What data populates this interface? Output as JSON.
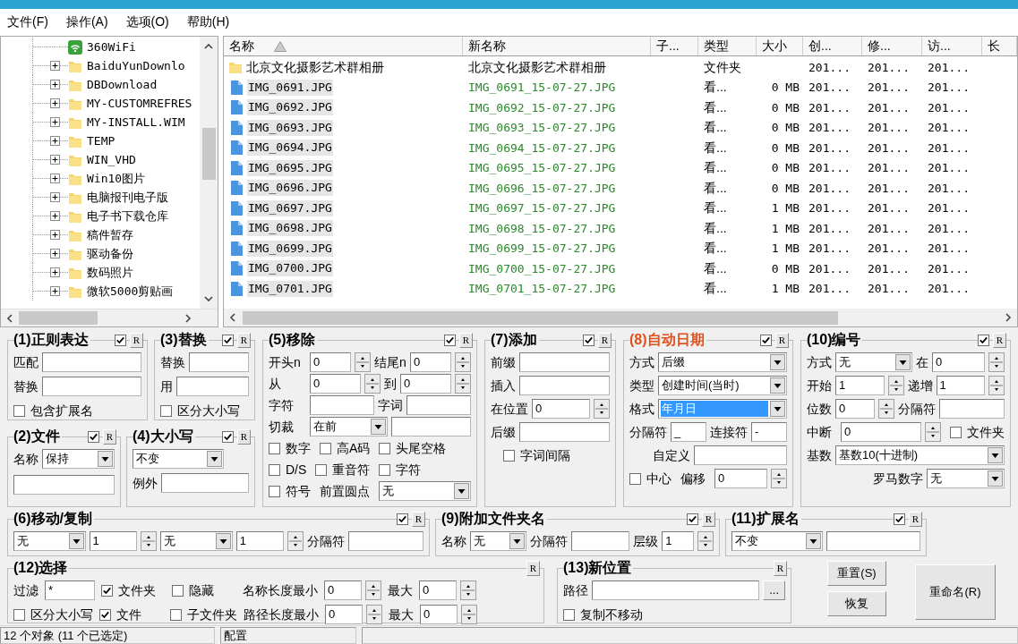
{
  "menu": [
    "文件(F)",
    "操作(A)",
    "选项(O)",
    "帮助(H)"
  ],
  "tree": {
    "items": [
      {
        "label": "360WiFi",
        "kind": "wifi"
      },
      {
        "label": "BaiduYunDownlo",
        "kind": "folder",
        "expanded": false
      },
      {
        "label": "DBDownload",
        "kind": "folder",
        "expanded": false
      },
      {
        "label": "MY-CUSTOMREFRES",
        "kind": "folder",
        "expanded": false
      },
      {
        "label": "MY-INSTALL.WIM",
        "kind": "folder",
        "expanded": false
      },
      {
        "label": "TEMP",
        "kind": "folder",
        "expanded": false
      },
      {
        "label": "WIN_VHD",
        "kind": "folder",
        "expanded": false
      },
      {
        "label": "Win10图片",
        "kind": "folder",
        "expanded": false
      },
      {
        "label": "电脑报刊电子版",
        "kind": "folder",
        "expanded": false
      },
      {
        "label": "电子书下载仓库",
        "kind": "folder",
        "expanded": false
      },
      {
        "label": "稿件暂存",
        "kind": "folder",
        "expanded": false
      },
      {
        "label": "驱动备份",
        "kind": "folder",
        "expanded": false
      },
      {
        "label": "数码照片",
        "kind": "folder",
        "expanded": false
      },
      {
        "label": "微软5000剪贴画",
        "kind": "folder",
        "expanded": false
      }
    ]
  },
  "file_list": {
    "columns": [
      {
        "label": "名称",
        "sorted": true
      },
      {
        "label": "新名称"
      },
      {
        "label": "子..."
      },
      {
        "label": "类型"
      },
      {
        "label": "大小"
      },
      {
        "label": "创..."
      },
      {
        "label": "修..."
      },
      {
        "label": "访..."
      },
      {
        "label": "长"
      }
    ],
    "rows": [
      {
        "kind": "folder",
        "selected": false,
        "name": "北京文化摄影艺术群相册",
        "new_name": "北京文化摄影艺术群相册",
        "changed": false,
        "type": "文件夹",
        "column_6": "201...",
        "column_7": "201...",
        "column_8": "201..."
      },
      {
        "kind": "image",
        "selected": true,
        "name": "IMG_0691.JPG",
        "new_name": "IMG_0691_15-07-27.JPG",
        "changed": true,
        "type": "看...",
        "size": "0 MB",
        "column_6": "201...",
        "column_7": "201...",
        "column_8": "201..."
      },
      {
        "kind": "image",
        "selected": true,
        "name": "IMG_0692.JPG",
        "new_name": "IMG_0692_15-07-27.JPG",
        "changed": true,
        "type": "看...",
        "size": "0 MB",
        "column_6": "201...",
        "column_7": "201...",
        "column_8": "201..."
      },
      {
        "kind": "image",
        "selected": true,
        "name": "IMG_0693.JPG",
        "new_name": "IMG_0693_15-07-27.JPG",
        "changed": true,
        "type": "看...",
        "size": "0 MB",
        "column_6": "201...",
        "column_7": "201...",
        "column_8": "201..."
      },
      {
        "kind": "image",
        "selected": true,
        "name": "IMG_0694.JPG",
        "new_name": "IMG_0694_15-07-27.JPG",
        "changed": true,
        "type": "看...",
        "size": "0 MB",
        "column_6": "201...",
        "column_7": "201...",
        "column_8": "201..."
      },
      {
        "kind": "image",
        "selected": true,
        "name": "IMG_0695.JPG",
        "new_name": "IMG_0695_15-07-27.JPG",
        "changed": true,
        "type": "看...",
        "size": "0 MB",
        "column_6": "201...",
        "column_7": "201...",
        "column_8": "201..."
      },
      {
        "kind": "image",
        "selected": true,
        "name": "IMG_0696.JPG",
        "new_name": "IMG_0696_15-07-27.JPG",
        "changed": true,
        "type": "看...",
        "size": "0 MB",
        "column_6": "201...",
        "column_7": "201...",
        "column_8": "201..."
      },
      {
        "kind": "image",
        "selected": true,
        "name": "IMG_0697.JPG",
        "new_name": "IMG_0697_15-07-27.JPG",
        "changed": true,
        "type": "看...",
        "size": "1 MB",
        "column_6": "201...",
        "column_7": "201...",
        "column_8": "201..."
      },
      {
        "kind": "image",
        "selected": true,
        "name": "IMG_0698.JPG",
        "new_name": "IMG_0698_15-07-27.JPG",
        "changed": true,
        "type": "看...",
        "size": "1 MB",
        "column_6": "201...",
        "column_7": "201...",
        "column_8": "201..."
      },
      {
        "kind": "image",
        "selected": true,
        "name": "IMG_0699.JPG",
        "new_name": "IMG_0699_15-07-27.JPG",
        "changed": true,
        "type": "看...",
        "size": "1 MB",
        "column_6": "201...",
        "column_7": "201...",
        "column_8": "201..."
      },
      {
        "kind": "image",
        "selected": true,
        "name": "IMG_0700.JPG",
        "new_name": "IMG_0700_15-07-27.JPG",
        "changed": true,
        "type": "看...",
        "size": "0 MB",
        "column_6": "201...",
        "column_7": "201...",
        "column_8": "201..."
      },
      {
        "kind": "image",
        "selected": true,
        "name": "IMG_0701.JPG",
        "new_name": "IMG_0701_15-07-27.JPG",
        "changed": true,
        "type": "看...",
        "size": "1 MB",
        "column_6": "201...",
        "column_7": "201...",
        "column_8": "201..."
      }
    ]
  },
  "panels": [
    {
      "title": "(1)正则表达",
      "active": false,
      "enabled": true,
      "reset": "R",
      "rows": [
        {
          "items": [
            {
              "kind": "label",
              "text": "匹配"
            },
            {
              "kind": "input"
            }
          ]
        },
        {
          "items": [
            {
              "kind": "label",
              "text": "替换"
            },
            {
              "kind": "input"
            }
          ]
        },
        {
          "items": [
            {
              "kind": "checkbox",
              "label": "包含扩展名",
              "checked": false
            }
          ]
        }
      ]
    },
    {
      "title": "(2)文件",
      "active": false,
      "enabled": true,
      "reset": "R",
      "rows": [
        {
          "items": [
            {
              "kind": "label",
              "text": "名称"
            },
            {
              "kind": "dropdown",
              "value": "保持",
              "focused": false
            }
          ]
        },
        {
          "items": [
            {
              "kind": "input"
            }
          ]
        }
      ]
    },
    {
      "title": "(3)替换",
      "active": false,
      "enabled": true,
      "reset": "R",
      "rows": [
        {
          "items": [
            {
              "kind": "label",
              "text": "替换"
            },
            {
              "kind": "input"
            }
          ]
        },
        {
          "items": [
            {
              "kind": "label",
              "text": "用"
            },
            {
              "kind": "input"
            }
          ]
        },
        {
          "items": [
            {
              "kind": "checkbox",
              "label": "区分大小写",
              "checked": false
            }
          ]
        }
      ]
    },
    {
      "title": "(4)大小写",
      "active": false,
      "enabled": true,
      "reset": "R",
      "rows": [
        {
          "items": [
            {
              "kind": "dropdown",
              "value": "不变",
              "focused": false
            }
          ]
        },
        {
          "items": [
            {
              "kind": "label",
              "text": "例外"
            },
            {
              "kind": "input"
            }
          ]
        }
      ]
    },
    {
      "title": "(5)移除",
      "active": false,
      "enabled": true,
      "reset": "R",
      "rows": [
        {
          "items": [
            {
              "kind": "label",
              "text": "开头n"
            },
            {
              "kind": "spin",
              "value": "0"
            },
            {
              "kind": "label",
              "text": "结尾n"
            },
            {
              "kind": "spin",
              "value": "0"
            }
          ]
        },
        {
          "items": [
            {
              "kind": "label",
              "text": "从"
            },
            {
              "kind": "spin",
              "value": "0"
            },
            {
              "kind": "label",
              "text": "到"
            },
            {
              "kind": "spin",
              "value": "0"
            }
          ]
        },
        {
          "items": [
            {
              "kind": "label",
              "text": "字符"
            },
            {
              "kind": "input"
            },
            {
              "kind": "label",
              "text": "字词"
            },
            {
              "kind": "input"
            }
          ]
        },
        {
          "items": [
            {
              "kind": "label",
              "text": "切裁"
            },
            {
              "kind": "dropdown",
              "value": "在前",
              "focused": false
            },
            {
              "kind": "input"
            }
          ]
        },
        {
          "items": [
            {
              "kind": "checkbox",
              "label": "数字",
              "checked": false
            },
            {
              "kind": "checkbox",
              "label": "高A码",
              "checked": false
            },
            {
              "kind": "checkbox",
              "label": "头尾空格",
              "checked": false
            }
          ]
        },
        {
          "items": [
            {
              "kind": "checkbox",
              "label": "D/S",
              "checked": false
            },
            {
              "kind": "checkbox",
              "label": "重音符",
              "checked": false
            },
            {
              "kind": "checkbox",
              "label": "字符",
              "checked": false
            }
          ]
        },
        {
          "items": [
            {
              "kind": "checkbox",
              "label": "符号",
              "checked": false
            },
            {
              "kind": "label",
              "text": "前置圆点"
            },
            {
              "kind": "dropdown",
              "value": "无",
              "focused": false
            }
          ]
        }
      ]
    },
    {
      "title": "(6)移动/复制",
      "active": false,
      "enabled": true,
      "reset": "R",
      "rows": [
        {
          "items": [
            {
              "kind": "dropdown",
              "value": "无",
              "focused": false
            },
            {
              "kind": "spin",
              "value": "1"
            },
            {
              "kind": "dropdown",
              "value": "无",
              "focused": false
            },
            {
              "kind": "spin",
              "value": "1"
            },
            {
              "kind": "label",
              "text": "分隔符"
            },
            {
              "kind": "input"
            }
          ]
        }
      ]
    },
    {
      "title": "(7)添加",
      "active": false,
      "enabled": true,
      "reset": "R",
      "rows": [
        {
          "items": [
            {
              "kind": "label",
              "text": "前缀"
            },
            {
              "kind": "input"
            }
          ]
        },
        {
          "items": [
            {
              "kind": "label",
              "text": "插入"
            },
            {
              "kind": "input"
            }
          ]
        },
        {
          "items": [
            {
              "kind": "label",
              "text": "在位置"
            },
            {
              "kind": "spin",
              "value": "0"
            }
          ]
        },
        {
          "items": [
            {
              "kind": "label",
              "text": "后缀"
            },
            {
              "kind": "input"
            }
          ]
        },
        {
          "items": [
            {
              "kind": "checkbox",
              "label": "字词间隔",
              "checked": false
            }
          ]
        }
      ]
    },
    {
      "title": "(8)自动日期",
      "active": true,
      "enabled": true,
      "reset": "R",
      "rows": [
        {
          "items": [
            {
              "kind": "label",
              "text": "方式"
            },
            {
              "kind": "dropdown",
              "value": "后缀",
              "focused": false
            }
          ]
        },
        {
          "items": [
            {
              "kind": "label",
              "text": "类型"
            },
            {
              "kind": "dropdown",
              "value": "创建时间(当时)",
              "focused": false
            }
          ]
        },
        {
          "items": [
            {
              "kind": "label",
              "text": "格式"
            },
            {
              "kind": "dropdown",
              "value": "年月日",
              "focused": true
            }
          ]
        },
        {
          "items": [
            {
              "kind": "label",
              "text": "分隔符"
            },
            {
              "kind": "input",
              "value": "_"
            },
            {
              "kind": "label",
              "text": "连接符"
            },
            {
              "kind": "input",
              "value": "-"
            }
          ]
        },
        {
          "items": [
            {
              "kind": "label",
              "text": "自定义"
            },
            {
              "kind": "input"
            }
          ]
        },
        {
          "items": [
            {
              "kind": "checkbox",
              "label": "中心",
              "checked": false
            },
            {
              "kind": "label",
              "text": "偏移"
            },
            {
              "kind": "spin",
              "value": "0"
            }
          ]
        }
      ]
    },
    {
      "title": "(9)附加文件夹名",
      "active": false,
      "enabled": true,
      "reset": "R",
      "rows": [
        {
          "items": [
            {
              "kind": "label",
              "text": "名称"
            },
            {
              "kind": "dropdown",
              "value": "无",
              "focused": false
            },
            {
              "kind": "label",
              "text": "分隔符"
            },
            {
              "kind": "input"
            },
            {
              "kind": "label",
              "text": "层级"
            },
            {
              "kind": "spin",
              "value": "1"
            }
          ]
        }
      ]
    },
    {
      "title": "(10)编号",
      "active": false,
      "enabled": true,
      "reset": "R",
      "rows": [
        {
          "items": [
            {
              "kind": "label",
              "text": "方式"
            },
            {
              "kind": "dropdown",
              "value": "无",
              "focused": false
            },
            {
              "kind": "label",
              "text": "在"
            },
            {
              "kind": "spin",
              "value": "0"
            }
          ]
        },
        {
          "items": [
            {
              "kind": "label",
              "text": "开始"
            },
            {
              "kind": "spin",
              "value": "1"
            },
            {
              "kind": "label",
              "text": "递增"
            },
            {
              "kind": "spin",
              "value": "1"
            }
          ]
        },
        {
          "items": [
            {
              "kind": "label",
              "text": "位数"
            },
            {
              "kind": "spin",
              "value": "0"
            },
            {
              "kind": "label",
              "text": "分隔符"
            },
            {
              "kind": "input"
            }
          ]
        },
        {
          "items": [
            {
              "kind": "label",
              "text": "中断"
            },
            {
              "kind": "spin",
              "value": "0"
            },
            {
              "kind": "checkbox",
              "label": "文件夹",
              "checked": false
            }
          ]
        },
        {
          "items": [
            {
              "kind": "label",
              "text": "基数"
            },
            {
              "kind": "dropdown",
              "value": "基数10(十进制)",
              "focused": false
            }
          ]
        },
        {
          "items": [
            {
              "kind": "label",
              "text": "罗马数字"
            },
            {
              "kind": "dropdown",
              "value": "无",
              "focused": false
            }
          ]
        }
      ]
    },
    {
      "title": "(11)扩展名",
      "active": false,
      "enabled": true,
      "reset": "R",
      "rows": [
        {
          "items": [
            {
              "kind": "dropdown",
              "value": "不变",
              "focused": false
            },
            {
              "kind": "input"
            }
          ]
        }
      ]
    },
    {
      "title": "(12)选择",
      "active": false,
      "reset": "R",
      "rows": [
        {
          "items": [
            {
              "kind": "label",
              "text": "过滤"
            },
            {
              "kind": "input",
              "value": "*"
            },
            {
              "kind": "checkbox",
              "label": "文件夹",
              "checked": true
            },
            {
              "kind": "checkbox",
              "label": "隐藏",
              "checked": false
            },
            {
              "kind": "label",
              "text": "名称长度最小"
            },
            {
              "kind": "spin",
              "value": "0"
            },
            {
              "kind": "label",
              "text": "最大"
            },
            {
              "kind": "spin",
              "value": "0"
            }
          ]
        },
        {
          "items": [
            {
              "kind": "checkbox",
              "label": "区分大小写",
              "checked": false
            },
            {
              "kind": "checkbox",
              "label": "文件",
              "checked": true
            },
            {
              "kind": "checkbox",
              "label": "子文件夹",
              "checked": false
            },
            {
              "kind": "label",
              "text": "路径长度最小"
            },
            {
              "kind": "spin",
              "value": "0"
            },
            {
              "kind": "label",
              "text": "最大"
            },
            {
              "kind": "spin",
              "value": "0"
            }
          ]
        }
      ]
    },
    {
      "title": "(13)新位置",
      "active": false,
      "reset": "R",
      "rows": [
        {
          "items": [
            {
              "kind": "label",
              "text": "路径"
            },
            {
              "kind": "input"
            },
            {
              "kind": "button",
              "label": "..."
            }
          ]
        },
        {
          "items": [
            {
              "kind": "checkbox",
              "label": "复制不移动",
              "checked": false
            }
          ]
        }
      ]
    }
  ],
  "actions": [
    {
      "label": "重置(S)"
    },
    {
      "label": "恢复"
    },
    {
      "label": "重命名(R)"
    }
  ],
  "status_bar": [
    "12 个对象 (11 个已选定)",
    "配置"
  ]
}
